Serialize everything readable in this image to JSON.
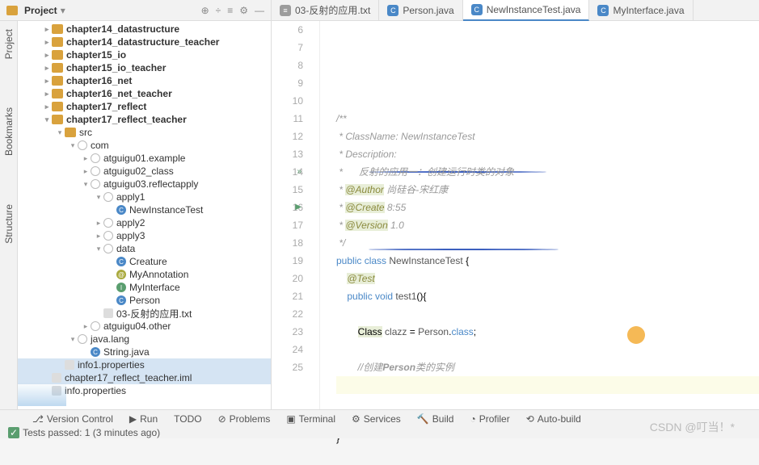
{
  "sidebar_vert": [
    "Project",
    "Bookmarks",
    "Structure"
  ],
  "project_header": {
    "title": "Project",
    "dropdown": "▾"
  },
  "header_icons": [
    "⊕",
    "÷",
    "≡",
    "⚙",
    "—"
  ],
  "tabs": [
    {
      "icon": "txt",
      "label": "03-反射的应用.txt",
      "active": false
    },
    {
      "icon": "java",
      "label": "Person.java",
      "active": false
    },
    {
      "icon": "java",
      "label": "NewInstanceTest.java",
      "active": true
    },
    {
      "icon": "java",
      "label": "MyInterface.java",
      "active": false
    }
  ],
  "tree": [
    {
      "indent": 0,
      "arrow": "▸",
      "bold": true,
      "icon": "folder",
      "label": "chapter14_datastructure"
    },
    {
      "indent": 0,
      "arrow": "▸",
      "bold": true,
      "icon": "folder",
      "label": "chapter14_datastructure_teacher"
    },
    {
      "indent": 0,
      "arrow": "▸",
      "bold": true,
      "icon": "folder",
      "label": "chapter15_io"
    },
    {
      "indent": 0,
      "arrow": "▸",
      "bold": true,
      "icon": "folder",
      "label": "chapter15_io_teacher"
    },
    {
      "indent": 0,
      "arrow": "▸",
      "bold": true,
      "icon": "folder",
      "label": "chapter16_net"
    },
    {
      "indent": 0,
      "arrow": "▸",
      "bold": true,
      "icon": "folder",
      "label": "chapter16_net_teacher"
    },
    {
      "indent": 0,
      "arrow": "▸",
      "bold": true,
      "icon": "folder",
      "label": "chapter17_reflect"
    },
    {
      "indent": 0,
      "arrow": "▾",
      "bold": true,
      "icon": "folder",
      "label": "chapter17_reflect_teacher"
    },
    {
      "indent": 1,
      "arrow": "▾",
      "icon": "folder",
      "label": "src"
    },
    {
      "indent": 2,
      "arrow": "▾",
      "icon": "pkg",
      "label": "com"
    },
    {
      "indent": 3,
      "arrow": "▸",
      "icon": "pkg",
      "label": "atguigu01.example"
    },
    {
      "indent": 3,
      "arrow": "▸",
      "icon": "pkg",
      "label": "atguigu02_class"
    },
    {
      "indent": 3,
      "arrow": "▾",
      "icon": "pkg",
      "label": "atguigu03.reflectapply"
    },
    {
      "indent": 4,
      "arrow": "▾",
      "icon": "pkg",
      "label": "apply1"
    },
    {
      "indent": 5,
      "arrow": "",
      "icon": "class",
      "label": "NewInstanceTest"
    },
    {
      "indent": 4,
      "arrow": "▸",
      "icon": "pkg",
      "label": "apply2"
    },
    {
      "indent": 4,
      "arrow": "▸",
      "icon": "pkg",
      "label": "apply3"
    },
    {
      "indent": 4,
      "arrow": "▾",
      "icon": "pkg",
      "label": "data"
    },
    {
      "indent": 5,
      "arrow": "",
      "icon": "class",
      "label": "Creature"
    },
    {
      "indent": 5,
      "arrow": "",
      "icon": "anno",
      "label": "MyAnnotation"
    },
    {
      "indent": 5,
      "arrow": "",
      "icon": "iface",
      "label": "MyInterface"
    },
    {
      "indent": 5,
      "arrow": "",
      "icon": "class",
      "label": "Person"
    },
    {
      "indent": 4,
      "arrow": "",
      "icon": "file",
      "label": "03-反射的应用.txt"
    },
    {
      "indent": 3,
      "arrow": "▸",
      "icon": "pkg",
      "label": "atguigu04.other"
    },
    {
      "indent": 2,
      "arrow": "▾",
      "icon": "pkg",
      "label": "java.lang"
    },
    {
      "indent": 3,
      "arrow": "",
      "icon": "class",
      "label": "String.java"
    },
    {
      "indent": 1,
      "arrow": "",
      "icon": "file",
      "label": "info1.properties",
      "sel": true
    },
    {
      "indent": 0,
      "arrow": "",
      "icon": "file",
      "label": "chapter17_reflect_teacher.iml",
      "sel": true
    },
    {
      "indent": 0,
      "arrow": "",
      "icon": "file",
      "label": "info.properties"
    }
  ],
  "code": {
    "start": 6,
    "lines": [
      {
        "n": 6,
        "html": "<span class='cm'>/**</span>"
      },
      {
        "n": 7,
        "html": "<span class='cm'> * ClassName: NewInstanceTest</span>"
      },
      {
        "n": 8,
        "html": "<span class='cm'> * Description:</span>"
      },
      {
        "n": 9,
        "html": "<span class='cm'> *      反射的应用一：创建运行时类的对象</span>"
      },
      {
        "n": 10,
        "html": "<span class='cm'> * <span class='cm-tag'>@Author</span> 尚硅谷-宋红康</span>"
      },
      {
        "n": 11,
        "html": "<span class='cm'> * <span class='cm-tag'>@Create</span> 8:55</span>"
      },
      {
        "n": 12,
        "html": "<span class='cm'> * <span class='cm-tag'>@Version</span> 1.0</span>"
      },
      {
        "n": 13,
        "html": "<span class='cm'> */</span>"
      },
      {
        "n": 14,
        "mark": "»",
        "html": "<span class='kw'>public class</span> <span class='dark'>NewInstanceTest</span> {"
      },
      {
        "n": 15,
        "html": "    <span class='cm-tag'>@Test</span>"
      },
      {
        "n": 16,
        "mark": "▶",
        "html": "    <span class='kw'>public void</span> <span class='dark'>test1</span>(){"
      },
      {
        "n": 17,
        "html": ""
      },
      {
        "n": 18,
        "html": "        <span class='hl'>Class</span> <span class='dark'>clazz</span> = <span class='dark'>Person</span>.<span class='kw'>class</span>;"
      },
      {
        "n": 19,
        "html": ""
      },
      {
        "n": 20,
        "html": "        <span class='cm'>//创建<span style='font-weight:bold'>Person</span>类的实例</span>"
      },
      {
        "n": 21,
        "cur": true,
        "html": ""
      },
      {
        "n": 22,
        "html": ""
      },
      {
        "n": 23,
        "html": "    }"
      },
      {
        "n": 24,
        "html": "}"
      },
      {
        "n": 25,
        "html": ""
      }
    ]
  },
  "bottom_tools": [
    {
      "icon": "⎇",
      "label": "Version Control"
    },
    {
      "icon": "▶",
      "label": "Run"
    },
    {
      "icon": "",
      "label": "TODO"
    },
    {
      "icon": "⊘",
      "label": "Problems"
    },
    {
      "icon": "▣",
      "label": "Terminal"
    },
    {
      "icon": "⚙",
      "label": "Services"
    },
    {
      "icon": "🔨",
      "label": "Build"
    },
    {
      "icon": "◔",
      "label": "Profiler"
    },
    {
      "icon": "⟲",
      "label": "Auto-build"
    }
  ],
  "status": {
    "icon": "✓",
    "text": "Tests passed: 1 (3 minutes ago)"
  },
  "watermark": "CSDN @叮当！*"
}
